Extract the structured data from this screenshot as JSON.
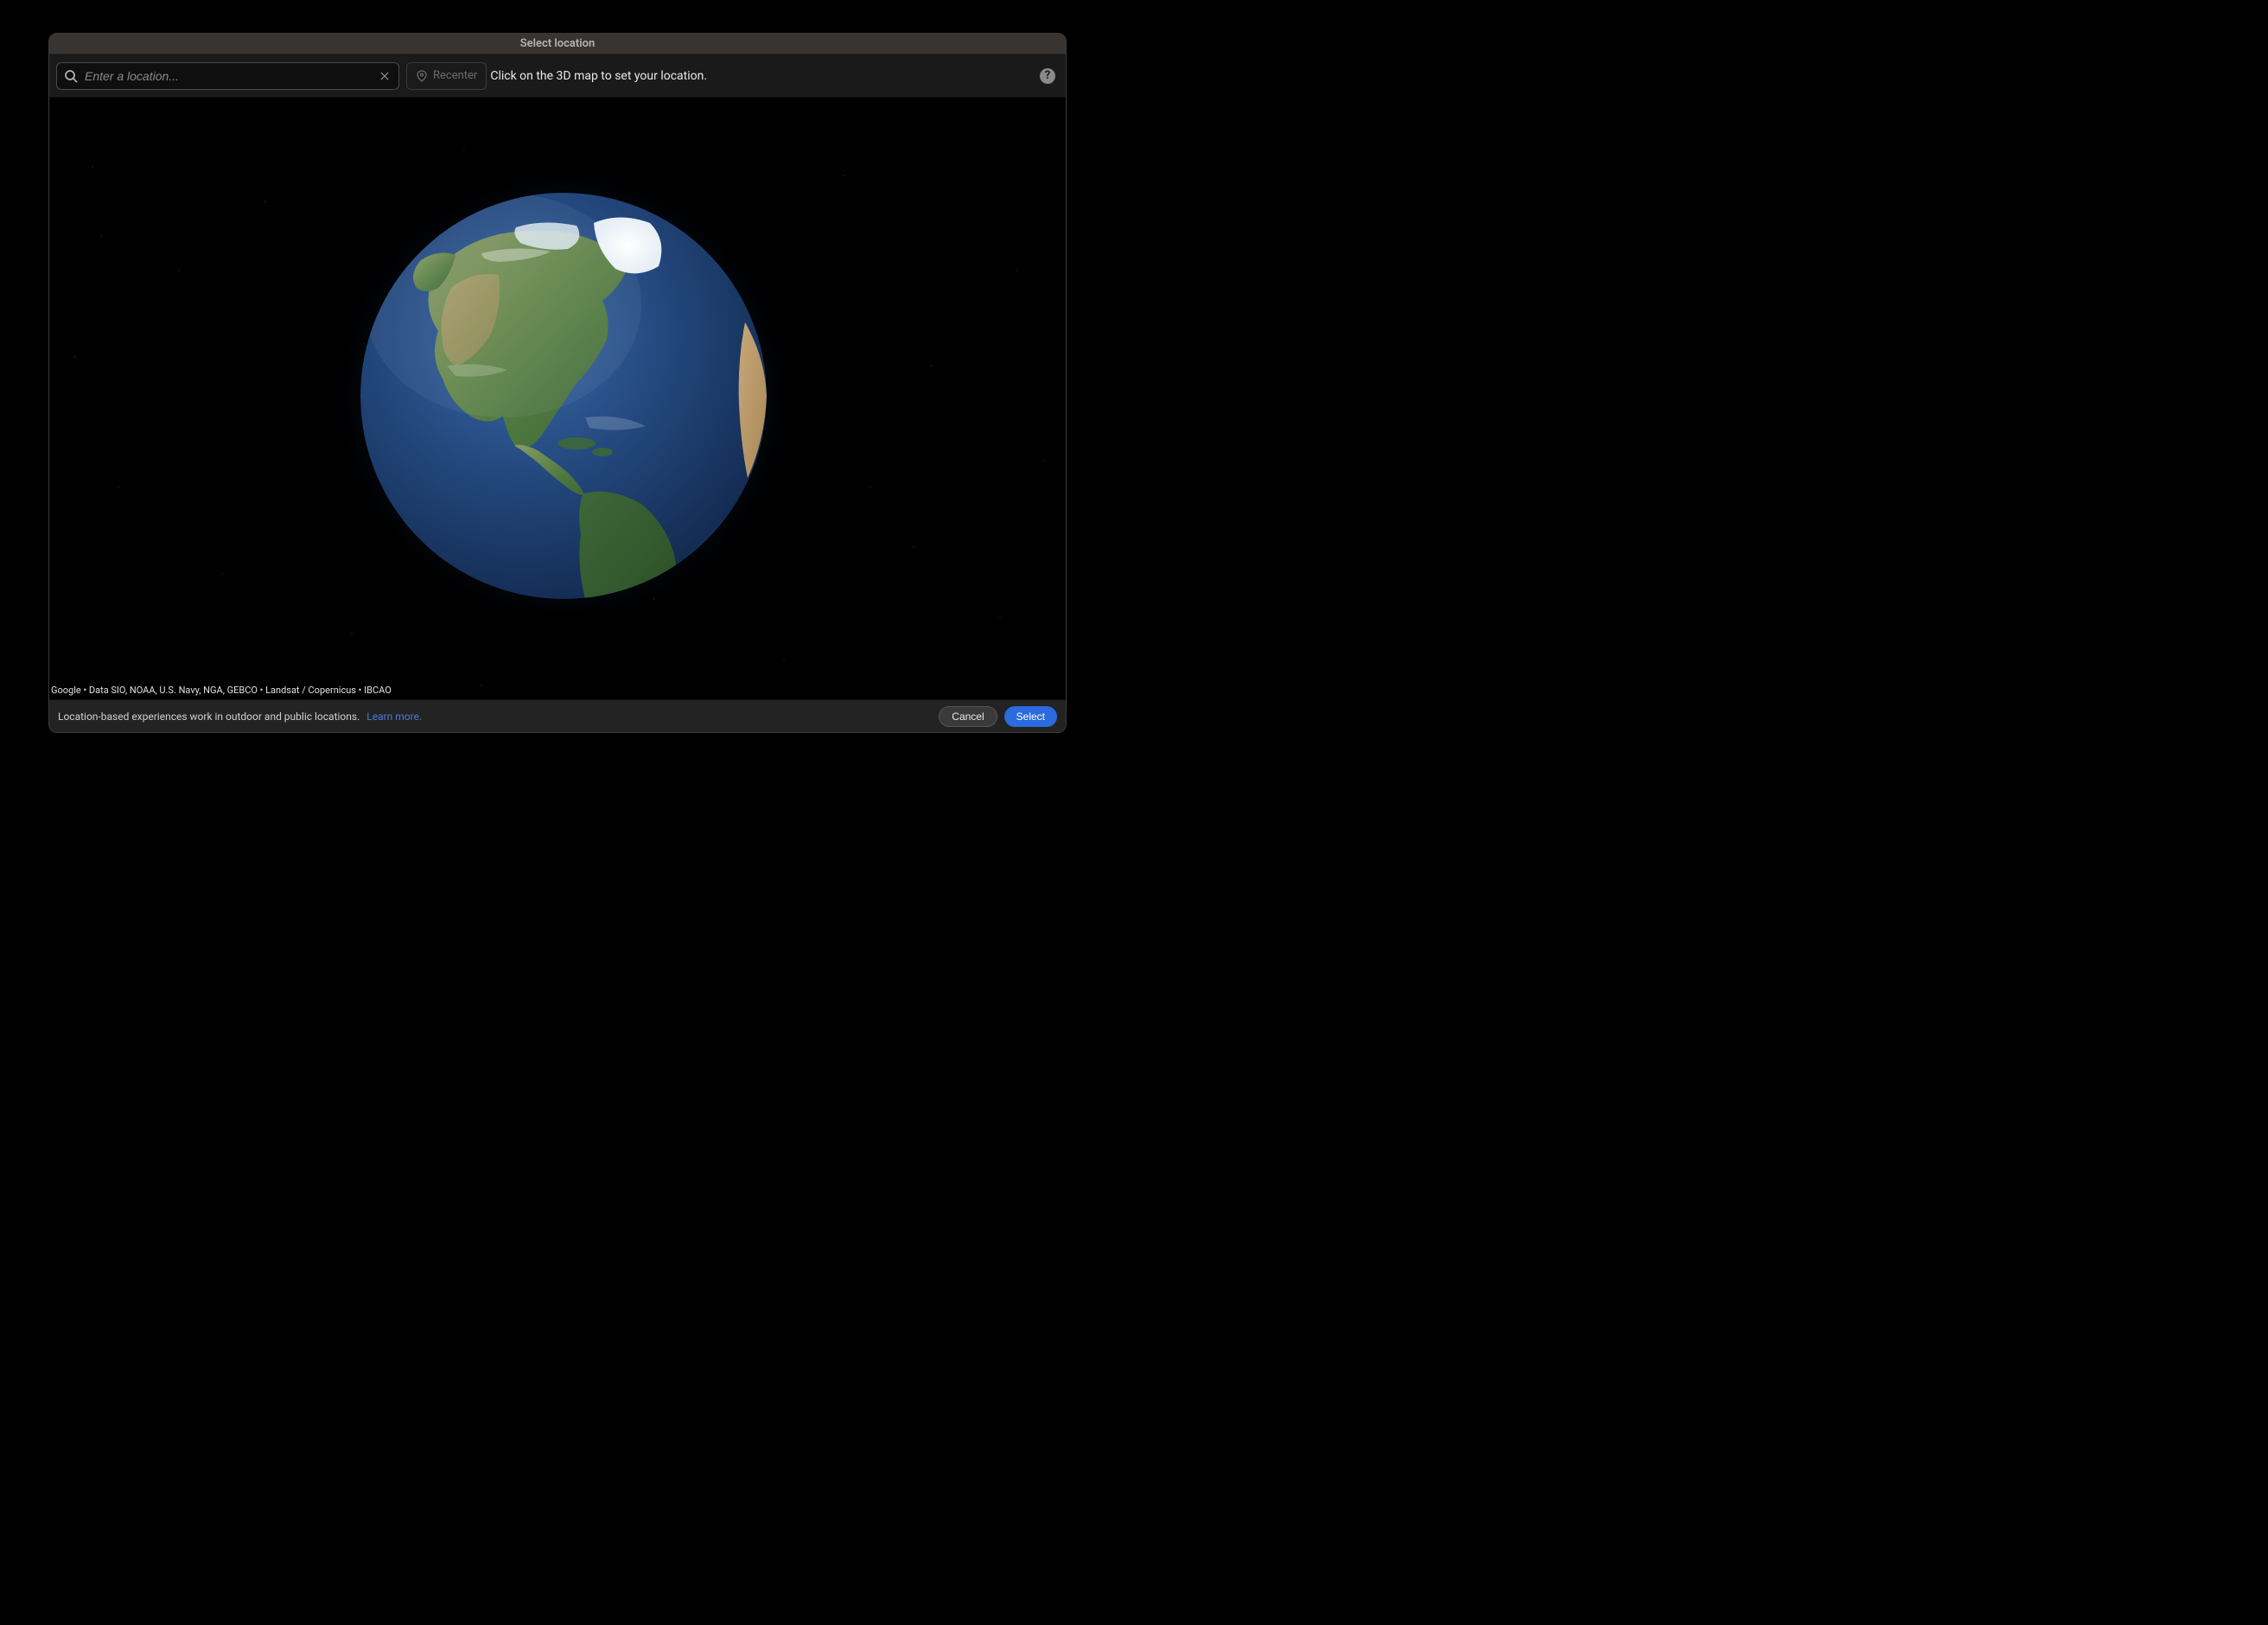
{
  "title": "Select location",
  "toolbar": {
    "search_placeholder": "Enter a location...",
    "recenter_label": "Recenter",
    "instruction": "Click on the 3D map to set your location."
  },
  "map": {
    "attribution": "Google • Data SIO, NOAA, U.S. Navy, NGA, GEBCO • Landsat / Copernicus • IBCAO"
  },
  "footer": {
    "info_text": "Location-based experiences work in outdoor and public locations.",
    "learn_more_label": "Learn more.",
    "cancel_label": "Cancel",
    "select_label": "Select"
  },
  "help": {
    "glyph": "?"
  }
}
